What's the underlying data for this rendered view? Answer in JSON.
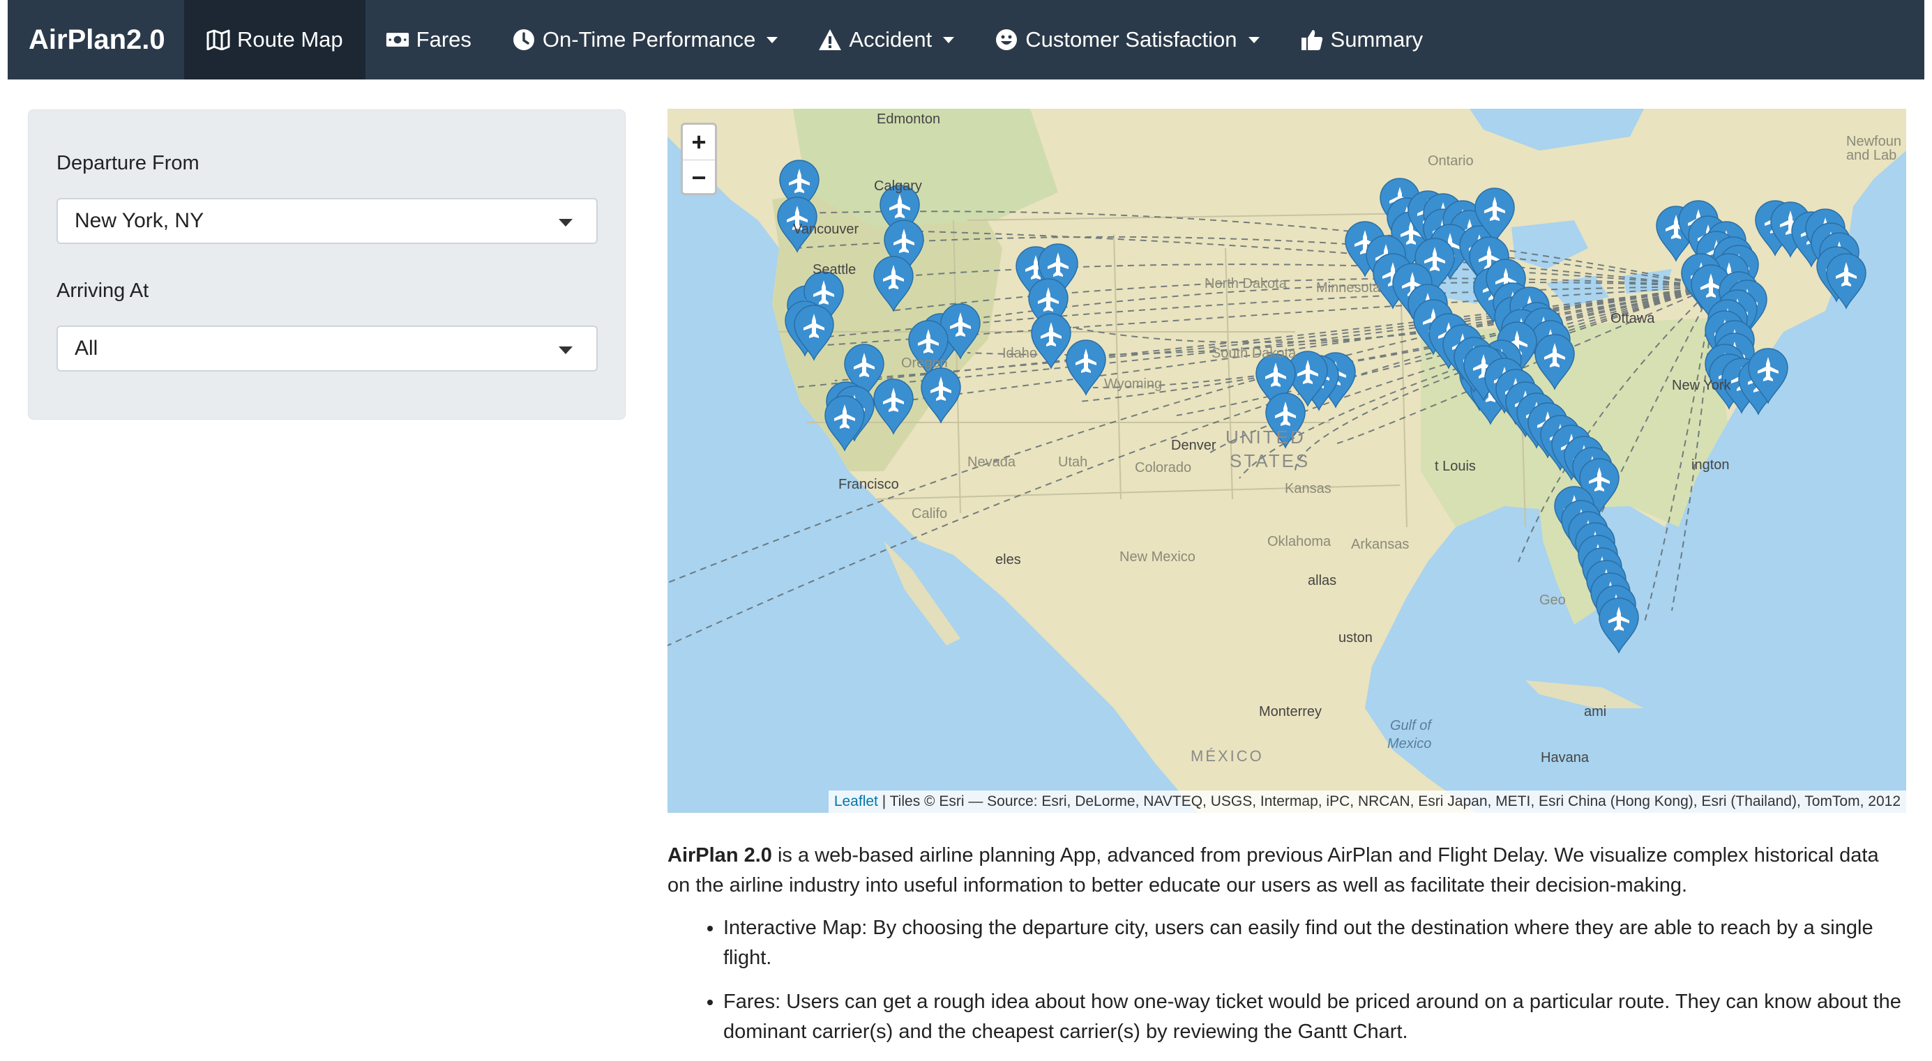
{
  "navbar": {
    "brand": "AirPlan2.0",
    "items": [
      {
        "label": "Route Map",
        "icon": "map-icon",
        "active": true,
        "dropdown": false
      },
      {
        "label": "Fares",
        "icon": "money-icon",
        "active": false,
        "dropdown": false
      },
      {
        "label": "On-Time Performance",
        "icon": "clock-icon",
        "active": false,
        "dropdown": true
      },
      {
        "label": "Accident",
        "icon": "warning-icon",
        "active": false,
        "dropdown": true
      },
      {
        "label": "Customer Satisfaction",
        "icon": "smile-icon",
        "active": false,
        "dropdown": true
      },
      {
        "label": "Summary",
        "icon": "thumbs-up-icon",
        "active": false,
        "dropdown": false
      }
    ],
    "background": "#2b3a4a",
    "active_background": "#1c2733"
  },
  "sidebar": {
    "departure_label": "Departure From",
    "departure_value": "New York, NY",
    "arrival_label": "Arriving At",
    "arrival_value": "All"
  },
  "map": {
    "zoom_in": "+",
    "zoom_out": "−",
    "attribution_link": "Leaflet",
    "attribution_text": " | Tiles © Esri — Source: Esri, DeLorme, NAVTEQ, USGS, Intermap, iPC, NRCAN, Esri Japan, METI, Esri China (Hong Kong), Esri (Thailand), TomTom, 2012",
    "marker_color": "#3a8fd0",
    "marker_icon": "plane-icon",
    "labels": {
      "edmonton": "Edmonton",
      "calgary": "Calgary",
      "vancouver": "Vancouver",
      "seattle": "Seattle",
      "ontario": "Ontario",
      "north_dakota": "North Dakota",
      "minnesota": "Minnesota",
      "south_dakota": "South Dakota",
      "oregon": "Oregon",
      "idaho": "Idaho",
      "wyoming": "Wyoming",
      "nevada": "Nevada",
      "utah": "Utah",
      "colorado": "Colorado",
      "san_francisco": "Francisco",
      "california": "Califo",
      "los_angeles": "eles",
      "new_mexico": "New Mexico",
      "oklahoma": "Oklahoma",
      "arkansas": "Arkansas",
      "dallas": "allas",
      "houston": "uston",
      "united_states": "UNITED",
      "states": "STATES",
      "ottawa": "Ottawa",
      "new_york": "New York",
      "washington": "ington",
      "miami": "ami",
      "monterrey": "Monterrey",
      "mexico": "MÉXICO",
      "havana": "Havana",
      "gulf": "Gulf of",
      "gulf2": "Mexico",
      "newfoundland": "Newfoun",
      "newfoundland2": "and Lab",
      "st_louis": "t Louis",
      "denver": "Denver",
      "kansas": "Kansas",
      "georgia": "Geo"
    }
  },
  "description": {
    "intro_bold": "AirPlan 2.0",
    "intro_rest": " is a web-based airline planning App, advanced from previous AirPlan and Flight Delay. We visualize complex historical data on the airline industry into useful information to better educate our users as well as facilitate their decision-making.",
    "bullets": [
      "Interactive Map: By choosing the departure city, users can easily find out the destination where they are able to reach by a single flight.",
      "Fares: Users can get a rough idea about how one-way ticket would be priced around on a particular route. They can know about the dominant carrier(s) and the cheapest carrier(s) by reviewing the Gantt Chart."
    ]
  }
}
